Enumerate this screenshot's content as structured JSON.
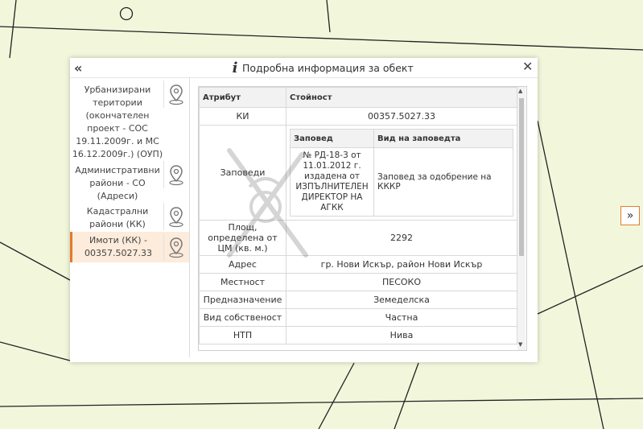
{
  "panel": {
    "title": "Подробна информация за обект",
    "collapse_icon": "double-chevron-left-icon",
    "info_icon": "info-icon",
    "close_icon": "close-icon",
    "expand_icon": "double-chevron-right-icon",
    "collapse_glyph": "«",
    "info_glyph": "i",
    "close_glyph": "✕",
    "expand_glyph": "»"
  },
  "layers": [
    {
      "label": "Урбанизирани територии (окончателен проект - СОС 19.11.2009г. и МС 16.12.2009г.) (ОУП)",
      "icon": "map-pin-icon",
      "active": false
    },
    {
      "label": "Административни райони - СО (Адреси)",
      "icon": "map-pin-icon",
      "active": false
    },
    {
      "label": "Кадастрални райони (КК)",
      "icon": "map-pin-icon",
      "active": false
    },
    {
      "label": "Имоти (КК) - 00357.5027.33",
      "icon": "map-pin-icon",
      "active": true
    }
  ],
  "table": {
    "headers": {
      "attribute": "Атрибут",
      "value": "Стойност"
    },
    "rows": {
      "ki": {
        "attr": "КИ",
        "value": "00357.5027.33"
      },
      "zapovedi": {
        "attr": "Заповеди",
        "inner_headers": {
          "order": "Заповед",
          "type": "Вид на заповедта"
        },
        "order": "№ РД-18-3 от 11.01.2012 г. издадена от ИЗПЪЛНИТЕЛЕН ДИРЕКТОР НА АГКК",
        "type": "Заповед за одобрение на КККР"
      },
      "area": {
        "attr": "Площ, определена от ЦМ (кв. м.)",
        "value": "2292"
      },
      "address": {
        "attr": "Адрес",
        "value": "гр. Нови Искър, район Нови Искър"
      },
      "locality": {
        "attr": "Местност",
        "value": "ПЕСОКО"
      },
      "purpose": {
        "attr": "Предназначение",
        "value": "Земеделска"
      },
      "ownership": {
        "attr": "Вид собственост",
        "value": "Частна"
      },
      "ntp": {
        "attr": "НТП",
        "value": "Нива"
      }
    }
  },
  "colors": {
    "accent": "#e37b2c",
    "map_bg": "#f2f7dc",
    "active_bg": "#fdebdb"
  }
}
